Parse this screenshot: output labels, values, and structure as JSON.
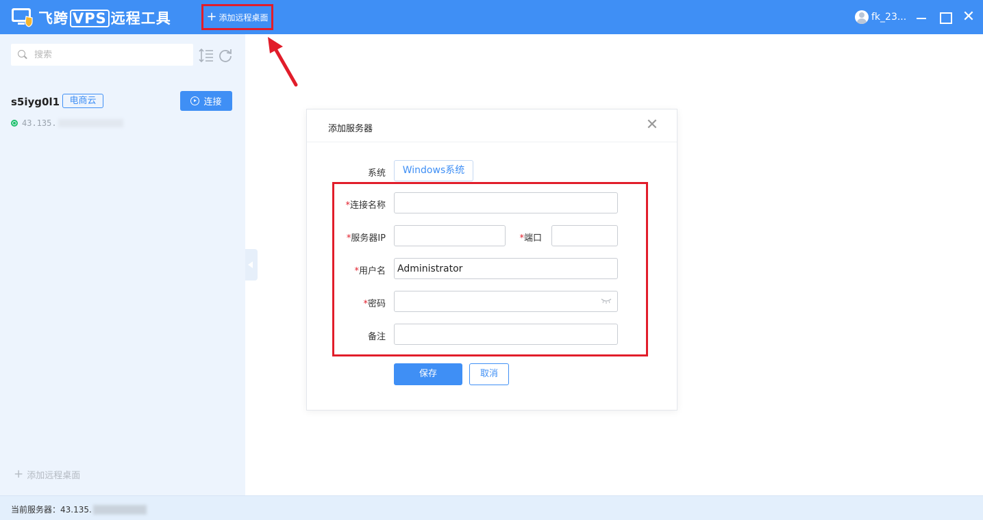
{
  "titlebar": {
    "app_title_prefix": "飞跨",
    "app_title_vps": "VPS",
    "app_title_suffix": "远程工具",
    "add_remote_label": "添加远程桌面",
    "username": "fk_23..."
  },
  "sidebar": {
    "search_placeholder": "搜索",
    "server": {
      "name": "s5iyg0l1",
      "tag": "电商云",
      "connect_label": "连接",
      "ip": "43.135."
    },
    "add_remote_label": "添加远程桌面"
  },
  "statusbar": {
    "label": "当前服务器：",
    "ip": "43.135."
  },
  "dialog": {
    "title": "添加服务器",
    "system_label": "系统",
    "system_value": "Windows系统",
    "required_mark": "*",
    "name_label": "连接名称",
    "ip_label": "服务器IP",
    "port_label": "端口",
    "username_label": "用户名",
    "username_value": "Administrator",
    "password_label": "密码",
    "note_label": "备注",
    "save_label": "保存",
    "cancel_label": "取消"
  },
  "colors": {
    "brand": "#3f8ff5",
    "highlight": "#e11d2a",
    "online": "#1ec06b"
  }
}
